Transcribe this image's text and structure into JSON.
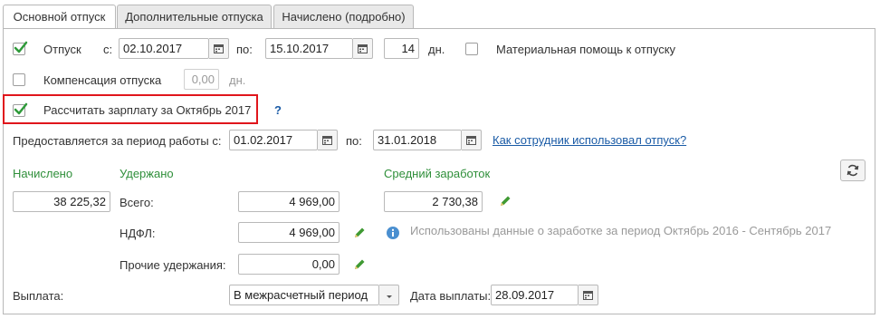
{
  "tabs": [
    {
      "label": "Основной отпуск",
      "active": true
    },
    {
      "label": "Дополнительные отпуска",
      "active": false
    },
    {
      "label": "Начислено (подробно)",
      "active": false
    }
  ],
  "vacation": {
    "checked": true,
    "label": "Отпуск",
    "from_label": "с:",
    "from_date": "02.10.2017",
    "to_label": "по:",
    "to_date": "15.10.2017",
    "days": "14",
    "days_unit": "дн."
  },
  "material_aid": {
    "checked": false,
    "label": "Материальная помощь к отпуску"
  },
  "compensation": {
    "checked": false,
    "label": "Компенсация отпуска",
    "value": "0,00",
    "unit": "дн."
  },
  "calc_salary": {
    "checked": true,
    "label": "Рассчитать зарплату за Октябрь 2017",
    "help": "?"
  },
  "work_period": {
    "label": "Предоставляется за период работы с:",
    "from_date": "01.02.2017",
    "to_label": "по:",
    "to_date": "31.01.2018",
    "link": "Как сотрудник использовал отпуск?"
  },
  "accrued": {
    "header": "Начислено",
    "value": "38 225,32"
  },
  "withheld": {
    "header": "Удержано",
    "total_label": "Всего:",
    "total_value": "4 969,00",
    "ndfl_label": "НДФЛ:",
    "ndfl_value": "4 969,00",
    "other_label": "Прочие удержания:",
    "other_value": "0,00"
  },
  "average": {
    "header": "Средний заработок",
    "value": "2 730,38",
    "info": "Использованы данные о заработке за период Октябрь 2016 - Сентябрь 2017"
  },
  "payment": {
    "label": "Выплата:",
    "selected": "В межрасчетный период",
    "date_label": "Дата выплаты:",
    "date": "28.09.2017"
  },
  "colors": {
    "accent_green": "#2f8f3a",
    "highlight_red": "#e0161c",
    "link_blue": "#1a5ba6"
  },
  "icons": [
    "checkbox-check-icon",
    "calendar-icon",
    "pencil-icon",
    "info-icon",
    "refresh-icon",
    "dropdown-arrow-icon"
  ]
}
